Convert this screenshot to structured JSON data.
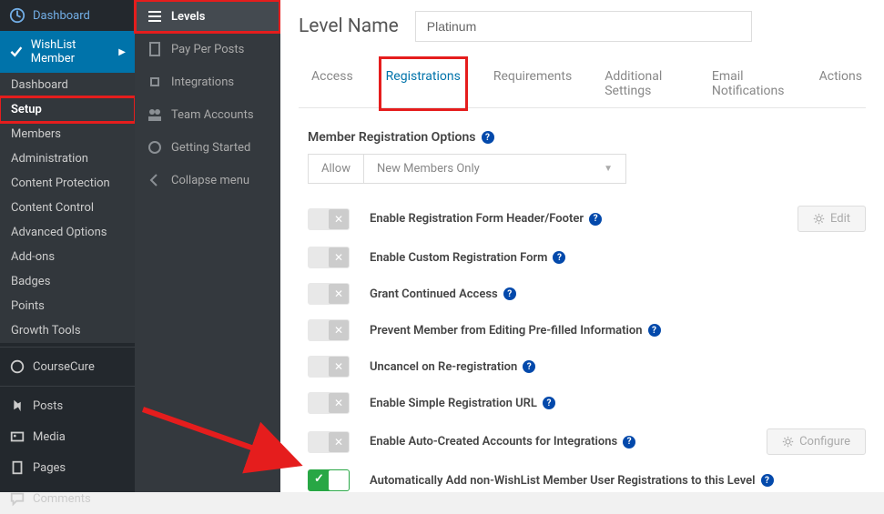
{
  "wp_sidebar": {
    "dashboard": "Dashboard",
    "wlm": "WishList Member",
    "subs": [
      "Dashboard",
      "Setup",
      "Members",
      "Administration",
      "Content Protection",
      "Content Control",
      "Advanced Options",
      "Add-ons",
      "Badges",
      "Points",
      "Growth Tools"
    ],
    "coursecure": "CourseCure",
    "posts": "Posts",
    "media": "Media",
    "pages": "Pages",
    "comments": "Comments"
  },
  "wlm_sidebar": {
    "items": [
      "Levels",
      "Pay Per Posts",
      "Integrations",
      "Team Accounts",
      "Getting Started",
      "Collapse menu"
    ]
  },
  "header": {
    "label": "Level Name",
    "value": "Platinum"
  },
  "tabs": [
    "Access",
    "Registrations",
    "Requirements",
    "Additional Settings",
    "Email Notifications",
    "Actions"
  ],
  "section": {
    "title": "Member Registration Options",
    "allow_label": "Allow",
    "allow_value": "New Members Only"
  },
  "options": [
    {
      "label": "Enable Registration Form Header/Footer",
      "on": false,
      "action": "Edit"
    },
    {
      "label": "Enable Custom Registration Form",
      "on": false
    },
    {
      "label": "Grant Continued Access",
      "on": false
    },
    {
      "label": "Prevent Member from Editing Pre-filled Information",
      "on": false
    },
    {
      "label": "Uncancel on Re-registration",
      "on": false
    },
    {
      "label": "Enable Simple Registration URL",
      "on": false
    },
    {
      "label": "Enable Auto-Created Accounts for Integrations",
      "on": false,
      "action": "Configure"
    },
    {
      "label": "Automatically Add non-WishList Member User Registrations to this Level",
      "on": true
    }
  ]
}
